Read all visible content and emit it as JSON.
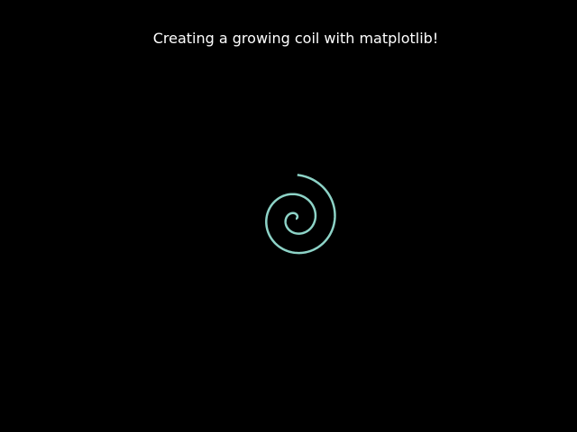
{
  "chart_data": {
    "type": "line",
    "title": "Creating a growing coil with matplotlib!",
    "xlabel": "",
    "ylabel": "",
    "axes_visible": false,
    "grid": false,
    "background_color": "#000000",
    "title_color": "#ffffff",
    "series": [
      {
        "color": "#8dd3c7",
        "function": "polar spiral r = theta, x = r·cos(theta), y = r·sin(theta)",
        "theta_start": 0,
        "theta_end": 14.1,
        "x": [
          0.0,
          0.48,
          0.58,
          0.11,
          -0.71,
          -1.4,
          -1.48,
          -0.69,
          0.72,
          2.11,
          2.81,
          2.45,
          1.02,
          -1.0,
          -2.85,
          -3.9,
          -3.69,
          -2.12,
          0.44,
          3.15,
          5.07,
          5.43,
          4.01,
          1.11,
          -2.35,
          -5.31,
          -6.81,
          -6.24,
          -3.71,
          0.0,
          3.83,
          6.75,
          7.97,
          7.15,
          4.55,
          0.88,
          -3.09,
          -6.38,
          -8.33,
          -8.53,
          -6.94,
          -3.92,
          -0.18,
          3.6,
          6.73,
          8.71,
          9.21
        ],
        "y": [
          0.0,
          0.26,
          0.9,
          1.49,
          1.63,
          1.06,
          -0.09,
          -1.41,
          -2.26,
          -2.15,
          -0.94,
          0.95,
          2.82,
          3.71,
          3.17,
          1.33,
          -1.2,
          -3.5,
          -4.62,
          -4.12,
          -2.11,
          1.03,
          4.0,
          5.64,
          5.33,
          3.27,
          0.04,
          -3.32,
          -5.99,
          -7.01,
          -6.15,
          -3.67,
          -0.15,
          3.36,
          6.2,
          7.85,
          8.03,
          6.69,
          3.91,
          0.47,
          -3.35,
          -6.63,
          -8.73,
          -9.09,
          -7.64,
          -4.68,
          -0.85
        ]
      }
    ]
  }
}
